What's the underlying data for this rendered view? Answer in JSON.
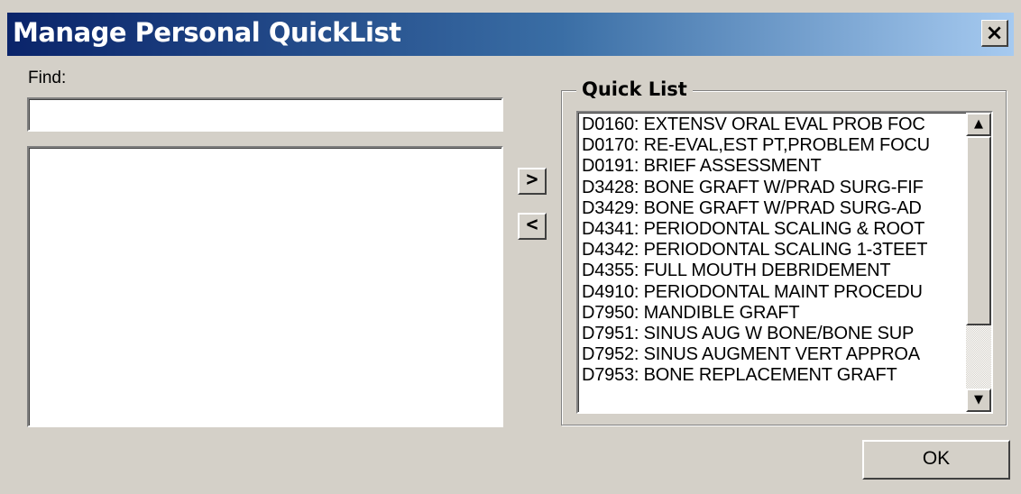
{
  "window": {
    "title": "Manage Personal QuickList",
    "close_glyph": "×"
  },
  "find": {
    "label": "Find:",
    "value": "",
    "placeholder": ""
  },
  "left_list": {
    "items": []
  },
  "move_buttons": {
    "add_glyph": ">",
    "remove_glyph": "<"
  },
  "quick_list": {
    "title": "Quick List",
    "items": [
      "D0160:  EXTENSV ORAL EVAL PROB FOC",
      "D0170:  RE-EVAL,EST PT,PROBLEM FOCU",
      "D0191:  BRIEF ASSESSMENT",
      "D3428:  BONE GRAFT W/PRAD SURG-FIF",
      "D3429:  BONE GRAFT W/PRAD SURG-AD",
      "D4341:  PERIODONTAL SCALING & ROOT",
      "D4342:  PERIODONTAL SCALING 1-3TEET",
      "D4355:  FULL MOUTH DEBRIDEMENT",
      "D4910:  PERIODONTAL MAINT PROCEDU",
      "D7950:  MANDIBLE GRAFT",
      "D7951:  SINUS AUG W BONE/BONE SUP",
      "D7952:  SINUS AUGMENT VERT APPROA",
      "D7953:  BONE REPLACEMENT GRAFT"
    ],
    "scroll_up_icon": "▲",
    "scroll_down_icon": "▼"
  },
  "ok_button": {
    "label": "OK"
  },
  "colors": {
    "titlebar_start": "#0a246a",
    "titlebar_end": "#a6caf0",
    "dialog_bg": "#d4d0c8"
  }
}
